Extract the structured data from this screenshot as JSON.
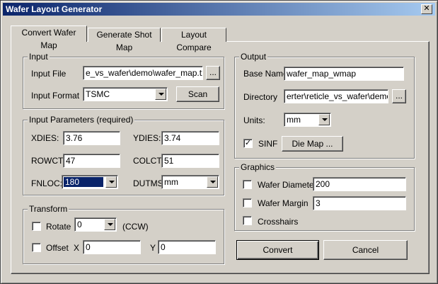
{
  "window": {
    "title": "Wafer Layout Generator",
    "close_glyph": "✕"
  },
  "tabs": [
    {
      "label": "Convert Wafer Map"
    },
    {
      "label": "Generate Shot Map"
    },
    {
      "label": "Layout Compare"
    }
  ],
  "input": {
    "group_title": "Input",
    "file_label": "Input File",
    "file_value": "e_vs_wafer\\demo\\wafer_map.txt",
    "browse_label": "...",
    "format_label": "Input Format",
    "format_value": "TSMC",
    "scan_label": "Scan"
  },
  "params": {
    "group_title": "Input Parameters (required)",
    "xdies_label": "XDIES:",
    "xdies_value": "3.76",
    "ydies_label": "YDIES:",
    "ydies_value": "3.74",
    "rowct_label": "ROWCT:",
    "rowct_value": "47",
    "colct_label": "COLCT:",
    "colct_value": "51",
    "fnloc_label": "FNLOC:",
    "fnloc_value": "180",
    "dutms_label": "DUTMS:",
    "dutms_value": "mm"
  },
  "transform": {
    "group_title": "Transform",
    "rotate_label": "Rotate",
    "rotate_checked": false,
    "rotate_value": "0",
    "ccw_label": "(CCW)",
    "offset_label": "Offset",
    "offset_checked": false,
    "x_label": "X",
    "x_value": "0",
    "y_label": "Y",
    "y_value": "0"
  },
  "output": {
    "group_title": "Output",
    "basename_label": "Base Name",
    "basename_value": "wafer_map_wmap",
    "directory_label": "Directory",
    "directory_value": "erter\\reticle_vs_wafer\\demo",
    "browse_label": "...",
    "units_label": "Units:",
    "units_value": "mm",
    "sinf_label": "SINF",
    "sinf_checked": true,
    "check_glyph": "✓",
    "diemap_label": "Die Map ..."
  },
  "graphics": {
    "group_title": "Graphics",
    "diameter_label": "Wafer Diameter",
    "diameter_checked": false,
    "diameter_value": "200",
    "margin_label": "Wafer Margin",
    "margin_checked": false,
    "margin_value": "3",
    "crosshairs_label": "Crosshairs",
    "crosshairs_checked": false
  },
  "actions": {
    "convert_label": "Convert",
    "cancel_label": "Cancel"
  },
  "colors": {
    "titlebar_start": "#0a246a",
    "titlebar_end": "#a6caf0",
    "selection": "#0a246a",
    "face": "#d4d0c8"
  }
}
